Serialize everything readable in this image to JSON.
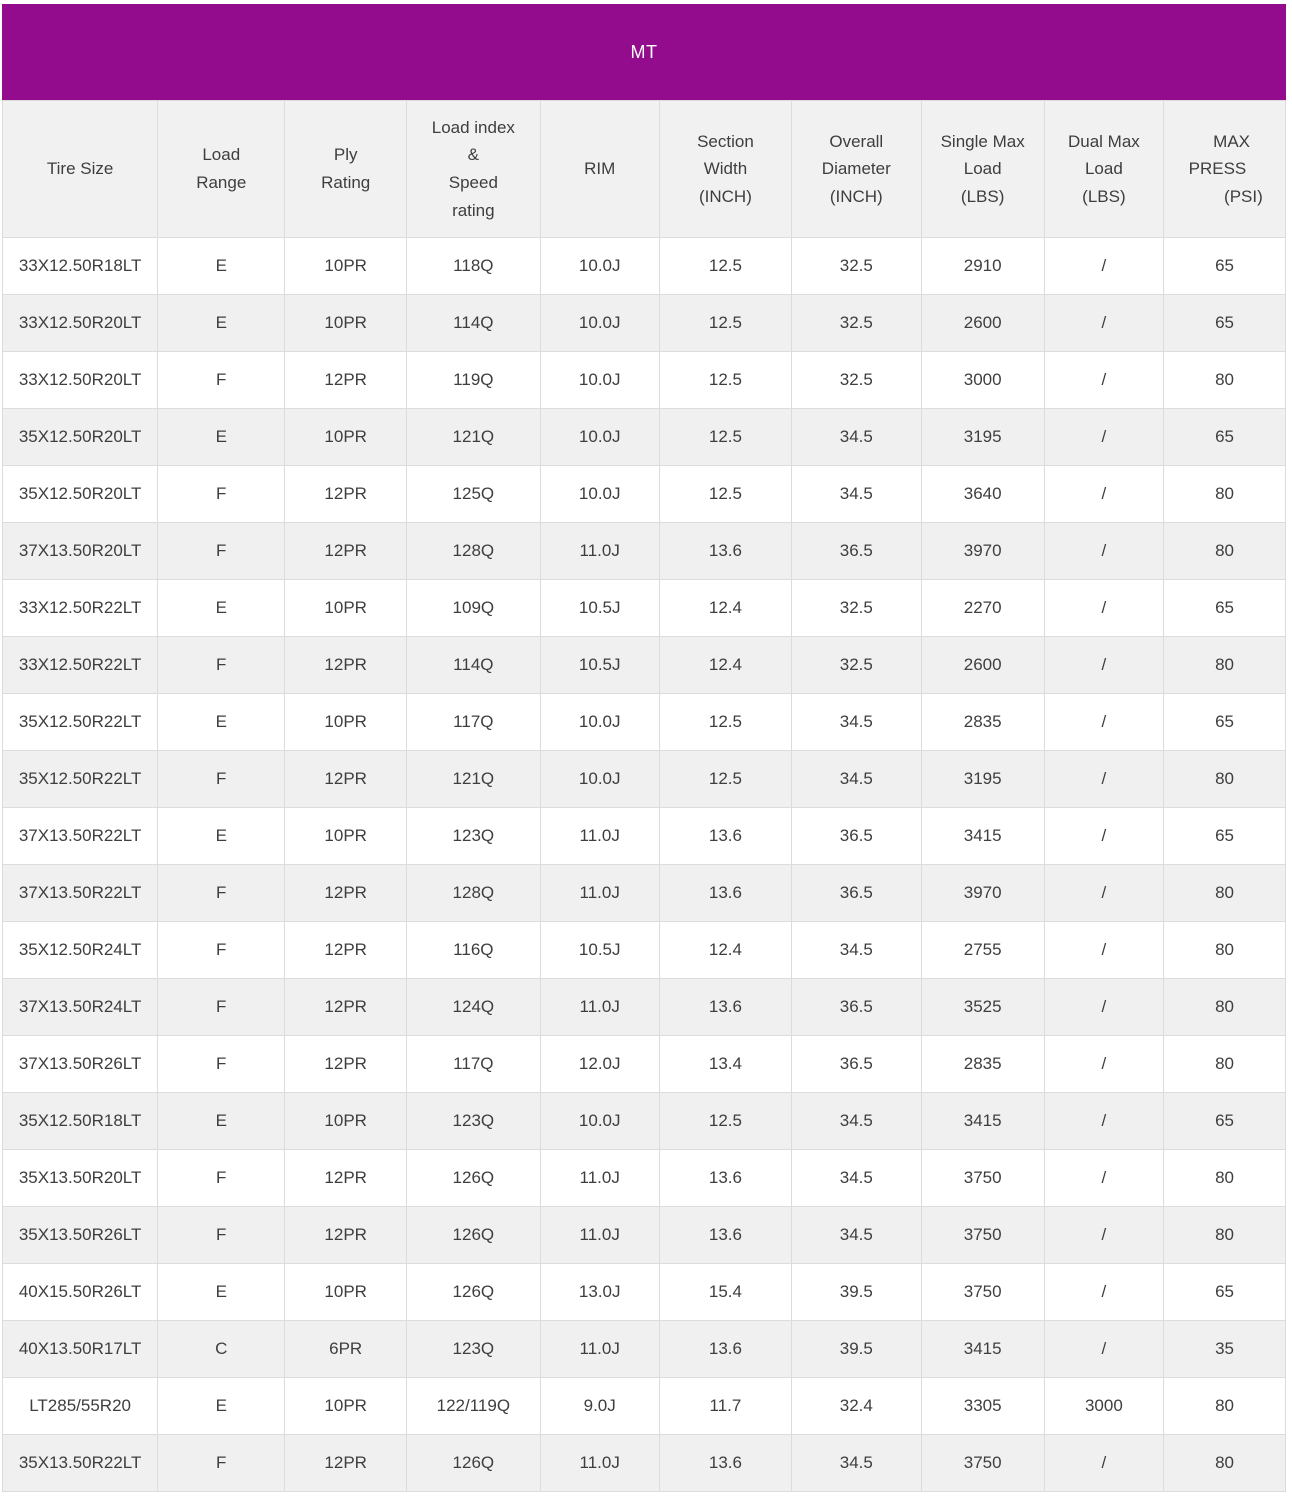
{
  "banner": {
    "title": "MT"
  },
  "colors": {
    "banner_bg": "#930c8d",
    "banner_text": "#ffffff",
    "header_bg": "#f1f1f1",
    "row_bg": "#ffffff",
    "row_alt_bg": "#f0f0f0",
    "border_color": "#dcdcdc",
    "text_color": "#3e3e3e"
  },
  "table": {
    "headers": [
      {
        "label": "Tire Size"
      },
      {
        "label": "Load\nRange"
      },
      {
        "label": "Ply\nRating"
      },
      {
        "label": "Load index\n&\nSpeed\nrating"
      },
      {
        "label": "RIM"
      },
      {
        "label": "Section\nWidth\n(INCH)"
      },
      {
        "label": "Overall\nDiameter\n(INCH)"
      },
      {
        "label": "Single Max\nLoad\n(LBS)"
      },
      {
        "label": "Dual Max\nLoad\n(LBS)"
      },
      {
        "label": "   MAX\nPRESS   \n        (PSI)"
      }
    ],
    "rows": [
      [
        "33X12.50R18LT",
        "E",
        "10PR",
        "118Q",
        "10.0J",
        "12.5",
        "32.5",
        "2910",
        "/",
        "65"
      ],
      [
        "33X12.50R20LT",
        "E",
        "10PR",
        "114Q",
        "10.0J",
        "12.5",
        "32.5",
        "2600",
        "/",
        "65"
      ],
      [
        "33X12.50R20LT",
        "F",
        "12PR",
        "119Q",
        "10.0J",
        "12.5",
        "32.5",
        "3000",
        "/",
        "80"
      ],
      [
        "35X12.50R20LT",
        "E",
        "10PR",
        "121Q",
        "10.0J",
        "12.5",
        "34.5",
        "3195",
        "/",
        "65"
      ],
      [
        "35X12.50R20LT",
        "F",
        "12PR",
        "125Q",
        "10.0J",
        "12.5",
        "34.5",
        "3640",
        "/",
        "80"
      ],
      [
        "37X13.50R20LT",
        "F",
        "12PR",
        "128Q",
        "11.0J",
        "13.6",
        "36.5",
        "3970",
        "/",
        "80"
      ],
      [
        "33X12.50R22LT",
        "E",
        "10PR",
        "109Q",
        "10.5J",
        "12.4",
        "32.5",
        "2270",
        "/",
        "65"
      ],
      [
        "33X12.50R22LT",
        "F",
        "12PR",
        "114Q",
        "10.5J",
        "12.4",
        "32.5",
        "2600",
        "/",
        "80"
      ],
      [
        "35X12.50R22LT",
        "E",
        "10PR",
        "117Q",
        "10.0J",
        "12.5",
        "34.5",
        "2835",
        "/",
        "65"
      ],
      [
        "35X12.50R22LT",
        "F",
        "12PR",
        "121Q",
        "10.0J",
        "12.5",
        "34.5",
        "3195",
        "/",
        "80"
      ],
      [
        "37X13.50R22LT",
        "E",
        "10PR",
        "123Q",
        "11.0J",
        "13.6",
        "36.5",
        "3415",
        "/",
        "65"
      ],
      [
        "37X13.50R22LT",
        "F",
        "12PR",
        "128Q",
        "11.0J",
        "13.6",
        "36.5",
        "3970",
        "/",
        "80"
      ],
      [
        "35X12.50R24LT",
        "F",
        "12PR",
        "116Q",
        "10.5J",
        "12.4",
        "34.5",
        "2755",
        "/",
        "80"
      ],
      [
        "37X13.50R24LT",
        "F",
        "12PR",
        "124Q",
        "11.0J",
        "13.6",
        "36.5",
        "3525",
        "/",
        "80"
      ],
      [
        "37X13.50R26LT",
        "F",
        "12PR",
        "117Q",
        "12.0J",
        "13.4",
        "36.5",
        "2835",
        "/",
        "80"
      ],
      [
        "35X12.50R18LT",
        "E",
        "10PR",
        "123Q",
        "10.0J",
        "12.5",
        "34.5",
        "3415",
        "/",
        "65"
      ],
      [
        "35X13.50R20LT",
        "F",
        "12PR",
        "126Q",
        "11.0J",
        "13.6",
        "34.5",
        "3750",
        "/",
        "80"
      ],
      [
        "35X13.50R26LT",
        "F",
        "12PR",
        "126Q",
        "11.0J",
        "13.6",
        "34.5",
        "3750",
        "/",
        "80"
      ],
      [
        "40X15.50R26LT",
        "E",
        "10PR",
        "126Q",
        "13.0J",
        "15.4",
        "39.5",
        "3750",
        "/",
        "65"
      ],
      [
        "40X13.50R17LT",
        "C",
        "6PR",
        "123Q",
        "11.0J",
        "13.6",
        "39.5",
        "3415",
        "/",
        "35"
      ],
      [
        "LT285/55R20",
        "E",
        "10PR",
        "122/119Q",
        "9.0J",
        "11.7",
        "32.4",
        "3305",
        "3000",
        "80"
      ],
      [
        "35X13.50R22LT",
        "F",
        "12PR",
        "126Q",
        "11.0J",
        "13.6",
        "34.5",
        "3750",
        "/",
        "80"
      ]
    ]
  }
}
